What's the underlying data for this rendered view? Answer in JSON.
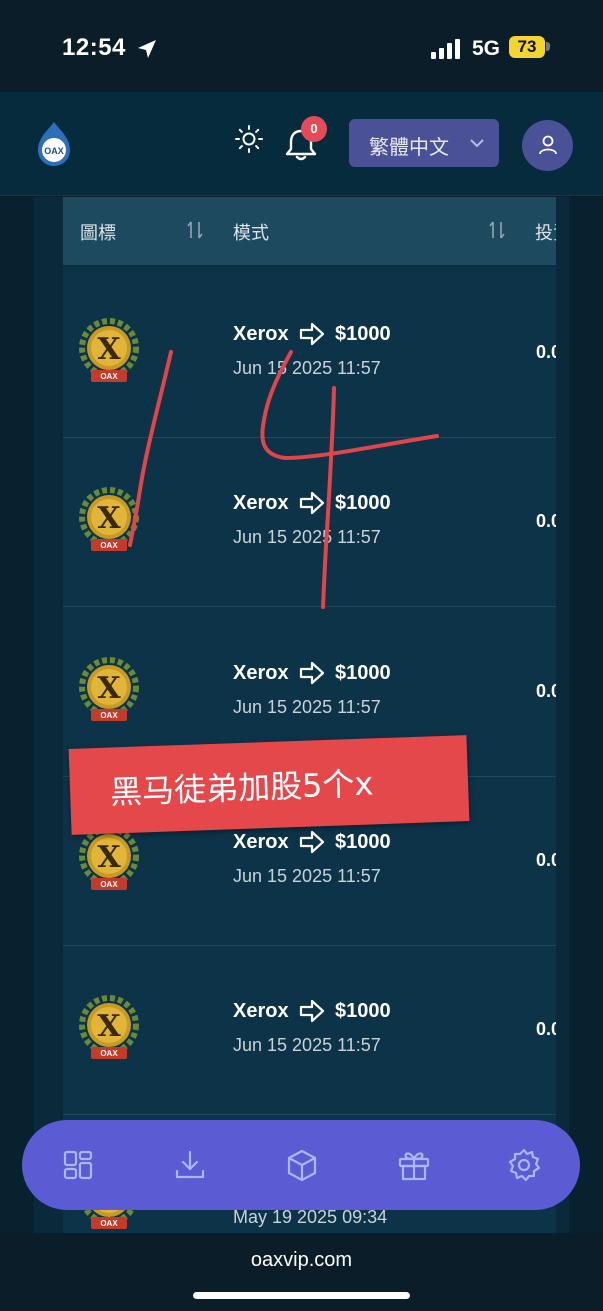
{
  "status_bar": {
    "time": "12:54",
    "network": "5G",
    "battery": "73"
  },
  "header": {
    "logo_text": "OAX",
    "notification_count": "0",
    "language": "繁體中文"
  },
  "table": {
    "columns": [
      {
        "label": "圖標"
      },
      {
        "label": "模式"
      },
      {
        "label": "投資"
      }
    ],
    "rows": [
      {
        "name": "Xerox",
        "amount": "$1000",
        "date": "Jun 15 2025 11:57",
        "value": "0.0",
        "badge": "OAX"
      },
      {
        "name": "Xerox",
        "amount": "$1000",
        "date": "Jun 15 2025 11:57",
        "value": "0.0",
        "badge": "OAX"
      },
      {
        "name": "Xerox",
        "amount": "$1000",
        "date": "Jun 15 2025 11:57",
        "value": "0.0",
        "badge": "OAX"
      },
      {
        "name": "Xerox",
        "amount": "$1000",
        "date": "Jun 15 2025 11:57",
        "value": "0.0",
        "badge": "OAX"
      },
      {
        "name": "Xerox",
        "amount": "$1000",
        "date": "Jun 15 2025 11:57",
        "value": "0.0",
        "badge": "OAX"
      },
      {
        "name": "",
        "amount": "",
        "date": "May 19 2025 09:34",
        "value": "",
        "badge": "OAX"
      }
    ]
  },
  "annotation": {
    "handwriting": "14",
    "sticker": "黑马徒弟加股5个x"
  },
  "bottom_nav": [
    "dashboard-icon",
    "download-icon",
    "box-icon",
    "gift-icon",
    "gear-icon"
  ],
  "browser": {
    "url": "oaxvip.com"
  },
  "colors": {
    "accent": "#5b5bd4",
    "badge": "#e44a57",
    "sticker": "#e5484b",
    "handwriting": "#e0454a"
  }
}
